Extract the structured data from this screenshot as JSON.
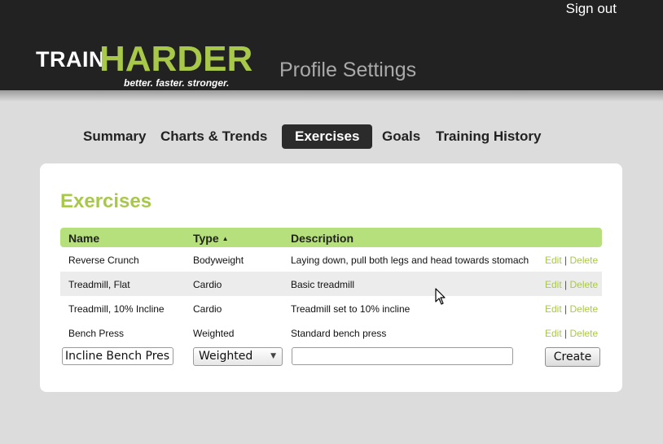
{
  "header": {
    "signout_label": "Sign out",
    "logo": {
      "train": "TRAIN",
      "harder": "HARDER",
      "tagline": "better. faster. stronger."
    },
    "page_title": "Profile Settings"
  },
  "nav": {
    "tabs": [
      "Summary",
      "Charts & Trends",
      "Exercises",
      "Goals",
      "Training History"
    ],
    "active": "Exercises"
  },
  "main": {
    "title": "Exercises",
    "columns": {
      "name": "Name",
      "type": "Type",
      "description": "Description"
    },
    "sort": {
      "column": "Type",
      "direction": "ascending",
      "indicator": "▲"
    },
    "rows": [
      {
        "name": "Reverse Crunch",
        "type": "Bodyweight",
        "description": "Laying down, pull both legs and head towards stomach",
        "edit": "Edit",
        "sep": "|",
        "delete": "Delete"
      },
      {
        "name": "Treadmill, Flat",
        "type": "Cardio",
        "description": "Basic treadmill",
        "edit": "Edit",
        "sep": "|",
        "delete": "Delete"
      },
      {
        "name": "Treadmill, 10% Incline",
        "type": "Cardio",
        "description": "Treadmill set to 10% incline",
        "edit": "Edit",
        "sep": "|",
        "delete": "Delete"
      },
      {
        "name": "Bench Press",
        "type": "Weighted",
        "description": "Standard bench press",
        "edit": "Edit",
        "sep": "|",
        "delete": "Delete"
      }
    ],
    "new_entry": {
      "name_value": "Incline Bench Press",
      "type_value": "Weighted",
      "description_value": "",
      "create_label": "Create"
    }
  },
  "colors": {
    "header_bg": "#222222",
    "accent_green": "#a8c84a",
    "table_header_bg": "#b6e07c",
    "page_bg": "#dcdcdc"
  }
}
